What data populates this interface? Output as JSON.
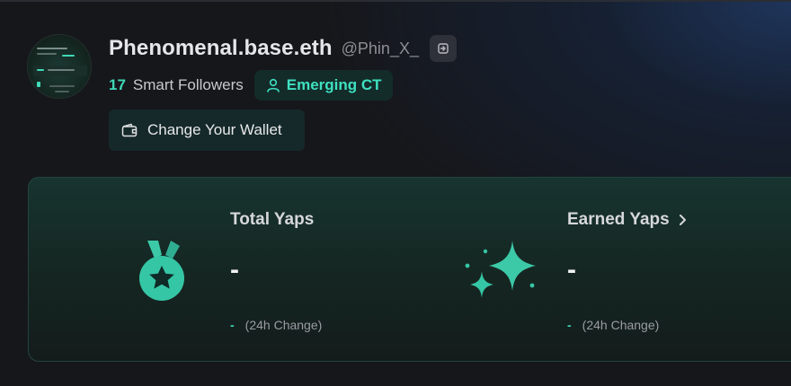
{
  "profile": {
    "display_name": "Phenomenal.base.eth",
    "handle": "@Phin_X_",
    "smart_followers_count": "17",
    "smart_followers_label": "Smart Followers",
    "badge_label": "Emerging CT"
  },
  "actions": {
    "change_wallet_label": "Change Your Wallet"
  },
  "stats": {
    "total": {
      "title": "Total Yaps",
      "value": "-",
      "change": "-",
      "change_label": "(24h Change)"
    },
    "earned": {
      "title": "Earned Yaps",
      "value": "-",
      "change": "-",
      "change_label": "(24h Change)"
    }
  },
  "icons": {
    "logout": "logout-icon",
    "badge": "user-icon",
    "wallet": "wallet-icon",
    "total": "medal-star-icon",
    "earned": "sparkles-icon",
    "earned_chevron": "chevron-right-icon"
  },
  "colors": {
    "accent": "#3fd9b9",
    "background": "#16171b",
    "card": "#152722"
  }
}
